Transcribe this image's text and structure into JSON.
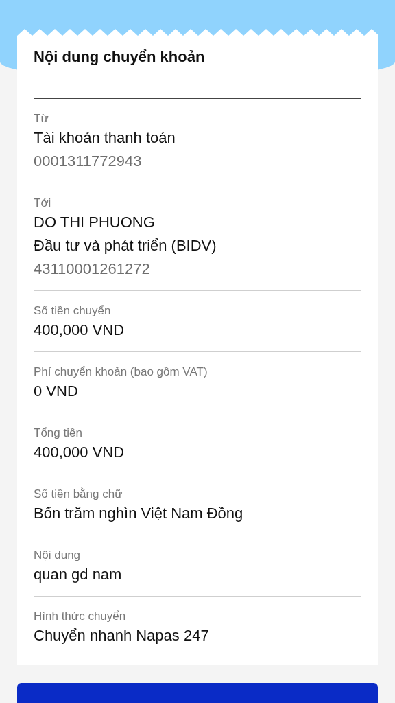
{
  "card": {
    "title": "Nội dung chuyển khoản",
    "sections": [
      {
        "label": "Từ",
        "lines": [
          {
            "text": "Tài khoản thanh toán",
            "kind": "primary"
          },
          {
            "text": "0001311772943",
            "kind": "secondary"
          }
        ]
      },
      {
        "label": "Tới",
        "lines": [
          {
            "text": "DO THI PHUONG",
            "kind": "primary"
          },
          {
            "text": "Đầu tư và phát triển (BIDV)",
            "kind": "primary"
          },
          {
            "text": "43110001261272",
            "kind": "secondary"
          }
        ]
      },
      {
        "label": "Số tiền chuyển",
        "lines": [
          {
            "text": "400,000 VND",
            "kind": "primary"
          }
        ]
      },
      {
        "label": "Phí chuyển khoản (bao gồm VAT)",
        "lines": [
          {
            "text": "0 VND",
            "kind": "primary"
          }
        ]
      },
      {
        "label": "Tổng tiền",
        "lines": [
          {
            "text": "400,000 VND",
            "kind": "primary"
          }
        ]
      },
      {
        "label": "Số tiền bằng chữ",
        "lines": [
          {
            "text": "Bốn trăm nghìn Việt Nam Đồng",
            "kind": "primary"
          }
        ]
      },
      {
        "label": "Nội dung",
        "lines": [
          {
            "text": "quan gd nam",
            "kind": "primary"
          }
        ]
      },
      {
        "label": "Hình thức chuyển",
        "lines": [
          {
            "text": "Chuyển nhanh Napas 247",
            "kind": "primary"
          }
        ]
      }
    ]
  }
}
